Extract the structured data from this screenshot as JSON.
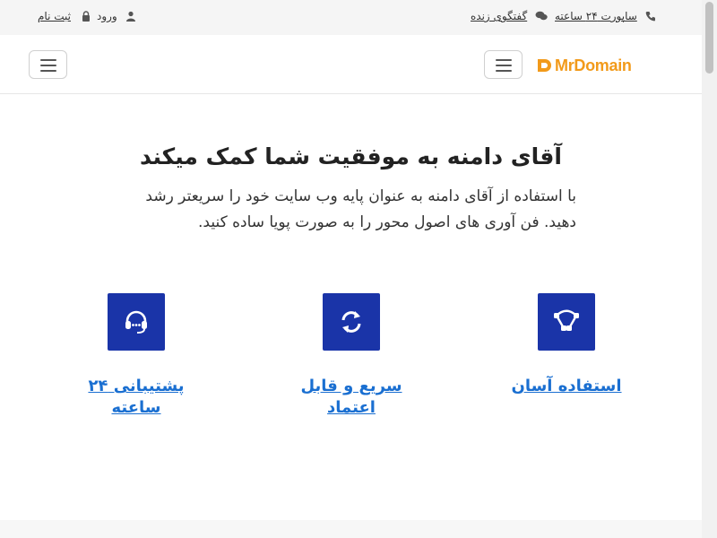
{
  "topbar": {
    "register_label": "ثبت نام",
    "login_label": "ورود",
    "chat_label": "گفتگوی زنده",
    "support_label": "ساپورت ۲۴ ساعته"
  },
  "header": {
    "logo_text": "MrDomain",
    "accent": "#f29a1a"
  },
  "hero": {
    "title": "آقای دامنه به موفقیت شما کمک میکند",
    "text": "با استفاده از آقای دامنه به عنوان پایه وب سایت خود را سریعتر رشد دهید. فن آوری های اصول محور را به صورت پویا ساده کنید."
  },
  "features": [
    {
      "title": "استفاده آسان",
      "icon": "bezier-curve-icon"
    },
    {
      "title": "سریع و قابل اعتماد",
      "icon": "sync-icon"
    },
    {
      "title": "پشتیبانی ۲۴ ساعته",
      "icon": "headset-icon"
    }
  ],
  "colors": {
    "feature_box": "#1a34a8",
    "link": "#1a6fd1"
  }
}
